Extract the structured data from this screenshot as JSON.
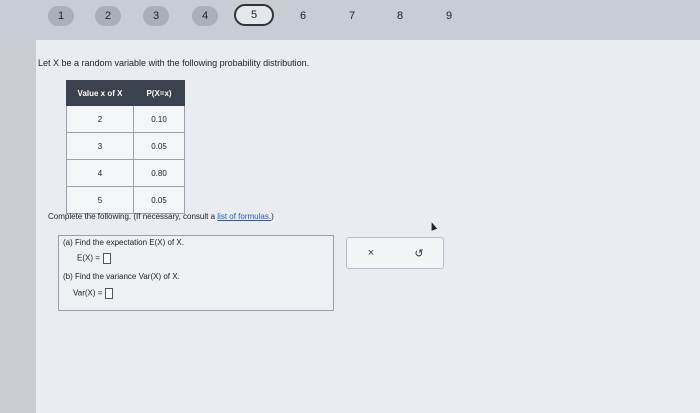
{
  "steps": [
    {
      "label": "1",
      "state": "done"
    },
    {
      "label": "2",
      "state": "done"
    },
    {
      "label": "3",
      "state": "done"
    },
    {
      "label": "4",
      "state": "done"
    },
    {
      "label": "5",
      "state": "current"
    },
    {
      "label": "6",
      "state": "todo"
    },
    {
      "label": "7",
      "state": "todo"
    },
    {
      "label": "8",
      "state": "todo"
    },
    {
      "label": "9",
      "state": "todo"
    }
  ],
  "question": {
    "prompt": "Let X be a random variable with the following probability distribution."
  },
  "table": {
    "headers": [
      "Value x of X",
      "P(X=x)"
    ],
    "rows": [
      {
        "x": "2",
        "p": "0.10"
      },
      {
        "x": "3",
        "p": "0.05"
      },
      {
        "x": "4",
        "p": "0.80"
      },
      {
        "x": "5",
        "p": "0.05"
      }
    ]
  },
  "instructions": {
    "text": "Complete the following. (If necessary, consult a ",
    "link": "list of formulas.",
    "suffix": ")"
  },
  "parts": {
    "a_label": "(a) Find the expectation E(X) of X.",
    "a_answer_label": "E(X) =",
    "b_label": "(b) Find the variance Var(X) of X.",
    "b_answer_label": "Var(X) ="
  },
  "buttons": {
    "clear": "×",
    "undo": "↺"
  },
  "colors": {
    "header_bg": "#3a4250",
    "link": "#2a55b5"
  }
}
